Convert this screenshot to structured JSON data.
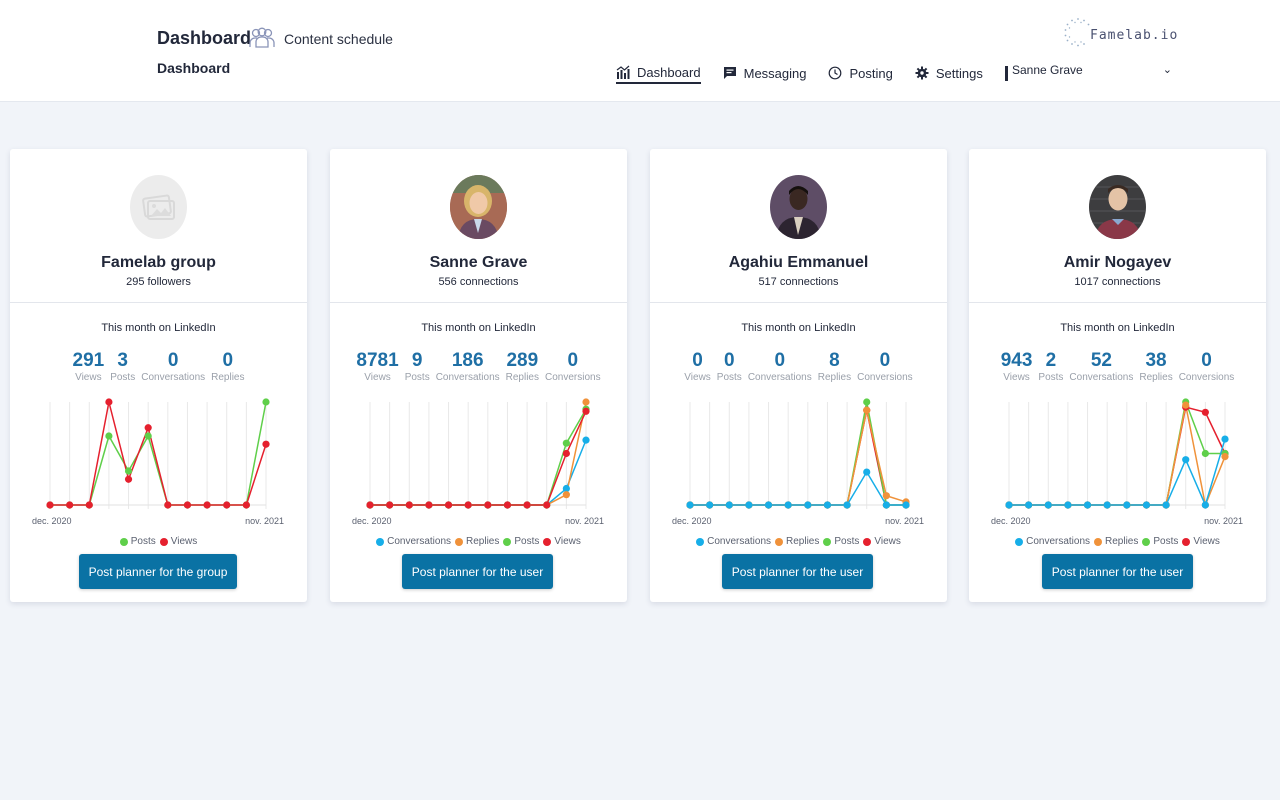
{
  "header": {
    "title": "Dashboard",
    "content_schedule": "Content schedule",
    "breadcrumb": "Dashboard",
    "logo_text": "Famelab.io",
    "nav": [
      {
        "label": "Dashboard",
        "icon": "chart-bars-icon",
        "active": true
      },
      {
        "label": "Messaging",
        "icon": "message-icon",
        "active": false
      },
      {
        "label": "Posting",
        "icon": "clock-icon",
        "active": false
      },
      {
        "label": "Settings",
        "icon": "gear-icon",
        "active": false
      }
    ],
    "user_select": {
      "value": "Sanne Grave"
    }
  },
  "colors": {
    "accent": "#0a72a4",
    "stat_value": "#1f6fa5",
    "conversations": "#17aee8",
    "replies": "#f0923a",
    "posts": "#5fcf4a",
    "views": "#e5202e"
  },
  "cards": [
    {
      "name": "Famelab group",
      "subtitle": "295 followers",
      "avatar": "placeholder-image",
      "section_title": "This month on LinkedIn",
      "stats": [
        {
          "value": "291",
          "label": "Views"
        },
        {
          "value": "3",
          "label": "Posts"
        },
        {
          "value": "0",
          "label": "Conversations"
        },
        {
          "value": "0",
          "label": "Replies"
        }
      ],
      "button_label": "Post planner for the group"
    },
    {
      "name": "Sanne Grave",
      "subtitle": "556 connections",
      "avatar": "photo-woman",
      "section_title": "This month on LinkedIn",
      "stats": [
        {
          "value": "8781",
          "label": "Views"
        },
        {
          "value": "9",
          "label": "Posts"
        },
        {
          "value": "186",
          "label": "Conversations"
        },
        {
          "value": "289",
          "label": "Replies"
        },
        {
          "value": "0",
          "label": "Conversions"
        }
      ],
      "button_label": "Post planner for the user"
    },
    {
      "name": "Agahiu Emmanuel",
      "subtitle": "517 connections",
      "avatar": "photo-man-purple",
      "section_title": "This month on LinkedIn",
      "stats": [
        {
          "value": "0",
          "label": "Views"
        },
        {
          "value": "0",
          "label": "Posts"
        },
        {
          "value": "0",
          "label": "Conversations"
        },
        {
          "value": "8",
          "label": "Replies"
        },
        {
          "value": "0",
          "label": "Conversions"
        }
      ],
      "button_label": "Post planner for the user"
    },
    {
      "name": "Amir Nogayev",
      "subtitle": "1017 connections",
      "avatar": "photo-man-brick",
      "section_title": "This month on LinkedIn",
      "stats": [
        {
          "value": "943",
          "label": "Views"
        },
        {
          "value": "2",
          "label": "Posts"
        },
        {
          "value": "52",
          "label": "Conversations"
        },
        {
          "value": "38",
          "label": "Replies"
        },
        {
          "value": "0",
          "label": "Conversions"
        }
      ],
      "button_label": "Post planner for the user"
    }
  ],
  "chart_data": [
    {
      "type": "line",
      "title": "Famelab group",
      "x_first_label": "dec. 2020",
      "x_last_label": "nov. 2021",
      "x": [
        "dec. 2020",
        "jan. 2021",
        "feb. 2021",
        "mar. 2021",
        "apr. 2021",
        "may 2021",
        "jun. 2021",
        "jul. 2021",
        "aug. 2021",
        "sep. 2021",
        "oct. 2021",
        "nov. 2021"
      ],
      "ylim": [
        0,
        1
      ],
      "grid": "vertical",
      "legend": "bottom",
      "series": [
        {
          "name": "Posts",
          "color": "#5fcf4a",
          "values": [
            0,
            0,
            0,
            0.67,
            0.33,
            0.67,
            0,
            0,
            0,
            0,
            0,
            1.0
          ]
        },
        {
          "name": "Views",
          "color": "#e5202e",
          "values": [
            0,
            0,
            0,
            1.0,
            0.25,
            0.75,
            0,
            0,
            0,
            0,
            0,
            0.59
          ]
        }
      ],
      "note": "values normalized per series (no y-axis shown)"
    },
    {
      "type": "line",
      "title": "Sanne Grave",
      "x_first_label": "dec. 2020",
      "x_last_label": "nov. 2021",
      "x": [
        "dec. 2020",
        "jan. 2021",
        "feb. 2021",
        "mar. 2021",
        "apr. 2021",
        "may 2021",
        "jun. 2021",
        "jul. 2021",
        "aug. 2021",
        "sep. 2021",
        "oct. 2021",
        "nov. 2021"
      ],
      "ylim": [
        0,
        1
      ],
      "grid": "vertical",
      "legend": "bottom",
      "series": [
        {
          "name": "Conversations",
          "color": "#17aee8",
          "values": [
            0,
            0,
            0,
            0,
            0,
            0,
            0,
            0,
            0,
            0,
            0.16,
            0.63
          ]
        },
        {
          "name": "Replies",
          "color": "#f0923a",
          "values": [
            0,
            0,
            0,
            0,
            0,
            0,
            0,
            0,
            0,
            0,
            0.1,
            1.0
          ]
        },
        {
          "name": "Posts",
          "color": "#5fcf4a",
          "values": [
            0,
            0,
            0,
            0,
            0,
            0,
            0,
            0,
            0,
            0,
            0.6,
            0.93
          ]
        },
        {
          "name": "Views",
          "color": "#e5202e",
          "values": [
            0,
            0,
            0,
            0,
            0,
            0,
            0,
            0,
            0,
            0,
            0.5,
            0.91
          ]
        }
      ],
      "note": "values normalized per series (no y-axis shown)"
    },
    {
      "type": "line",
      "title": "Agahiu Emmanuel",
      "x_first_label": "dec. 2020",
      "x_last_label": "nov. 2021",
      "x": [
        "dec. 2020",
        "jan. 2021",
        "feb. 2021",
        "mar. 2021",
        "apr. 2021",
        "may 2021",
        "jun. 2021",
        "jul. 2021",
        "aug. 2021",
        "sep. 2021",
        "oct. 2021",
        "nov. 2021"
      ],
      "ylim": [
        0,
        1
      ],
      "grid": "vertical",
      "legend": "bottom",
      "series": [
        {
          "name": "Views",
          "color": "#e5202e",
          "values": [
            0,
            0,
            0,
            0,
            0,
            0,
            0,
            0,
            0,
            0.92,
            0,
            0
          ]
        },
        {
          "name": "Posts",
          "color": "#5fcf4a",
          "values": [
            0,
            0,
            0,
            0,
            0,
            0,
            0,
            0,
            0,
            1.0,
            0,
            0
          ]
        },
        {
          "name": "Replies",
          "color": "#f0923a",
          "values": [
            0,
            0,
            0,
            0,
            0,
            0,
            0,
            0,
            0,
            0.92,
            0.09,
            0.03
          ]
        },
        {
          "name": "Conversations",
          "color": "#17aee8",
          "values": [
            0,
            0,
            0,
            0,
            0,
            0,
            0,
            0,
            0,
            0.32,
            0,
            0
          ]
        }
      ],
      "note": "values normalized per series (no y-axis shown)"
    },
    {
      "type": "line",
      "title": "Amir Nogayev",
      "x_first_label": "dec. 2020",
      "x_last_label": "nov. 2021",
      "x": [
        "dec. 2020",
        "jan. 2021",
        "feb. 2021",
        "mar. 2021",
        "apr. 2021",
        "may 2021",
        "jun. 2021",
        "jul. 2021",
        "aug. 2021",
        "sep. 2021",
        "oct. 2021",
        "nov. 2021"
      ],
      "ylim": [
        0,
        1
      ],
      "grid": "vertical",
      "legend": "bottom",
      "series": [
        {
          "name": "Views",
          "color": "#e5202e",
          "values": [
            0,
            0,
            0,
            0,
            0,
            0,
            0,
            0,
            0,
            0.95,
            0.9,
            0.5
          ]
        },
        {
          "name": "Posts",
          "color": "#5fcf4a",
          "values": [
            0,
            0,
            0,
            0,
            0,
            0,
            0,
            0,
            0,
            1.0,
            0.5,
            0.5
          ]
        },
        {
          "name": "Replies",
          "color": "#f0923a",
          "values": [
            0,
            0,
            0,
            0,
            0,
            0,
            0,
            0,
            0,
            0.97,
            0,
            0.47
          ]
        },
        {
          "name": "Conversations",
          "color": "#17aee8",
          "values": [
            0,
            0,
            0,
            0,
            0,
            0,
            0,
            0,
            0,
            0.44,
            0,
            0.64
          ]
        }
      ],
      "note": "values normalized per series (no y-axis shown)"
    }
  ]
}
